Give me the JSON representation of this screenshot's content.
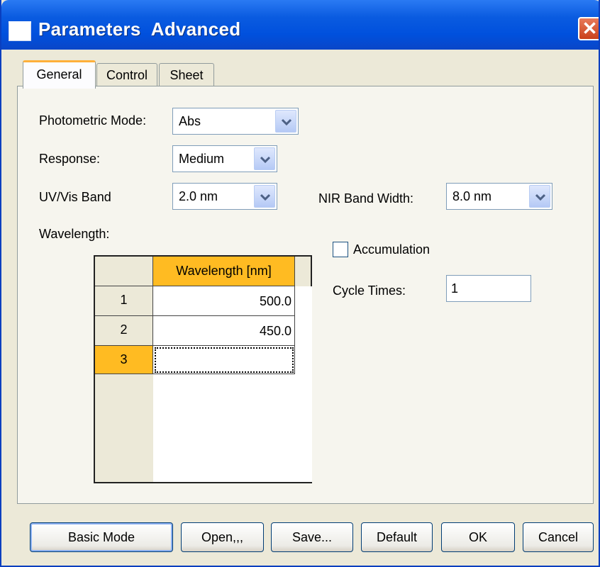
{
  "window": {
    "title": "Parameters  Advanced",
    "close_label": "✕"
  },
  "tabs": [
    {
      "label": "General",
      "active": true
    },
    {
      "label": "Control",
      "active": false
    },
    {
      "label": "Sheet",
      "active": false
    }
  ],
  "general": {
    "photometric_mode": {
      "label": "Photometric Mode:",
      "value": "Abs"
    },
    "response": {
      "label": "Response:",
      "value": "Medium"
    },
    "uvvis_band": {
      "label": "UV/Vis Band",
      "value": "2.0 nm"
    },
    "nir_band_width": {
      "label": "NIR Band Width:",
      "value": "8.0 nm"
    },
    "wavelength_label": "Wavelength:",
    "wavelength_table": {
      "column_header": "Wavelength [nm]",
      "rows": [
        {
          "index": "1",
          "value": "500.0"
        },
        {
          "index": "2",
          "value": "450.0"
        },
        {
          "index": "3",
          "value": ""
        }
      ]
    },
    "accumulation": {
      "label": "Accumulation",
      "checked": false
    },
    "cycle_times": {
      "label": "Cycle Times:",
      "value": "1"
    }
  },
  "buttons": {
    "basic_mode": "Basic Mode",
    "open": "Open,,,",
    "save": "Save...",
    "default": "Default",
    "ok": "OK",
    "cancel": "Cancel"
  },
  "colors": {
    "titlebar": "#0a5be0",
    "highlight": "#ffbb22",
    "dialog_bg": "#ece9d8"
  }
}
